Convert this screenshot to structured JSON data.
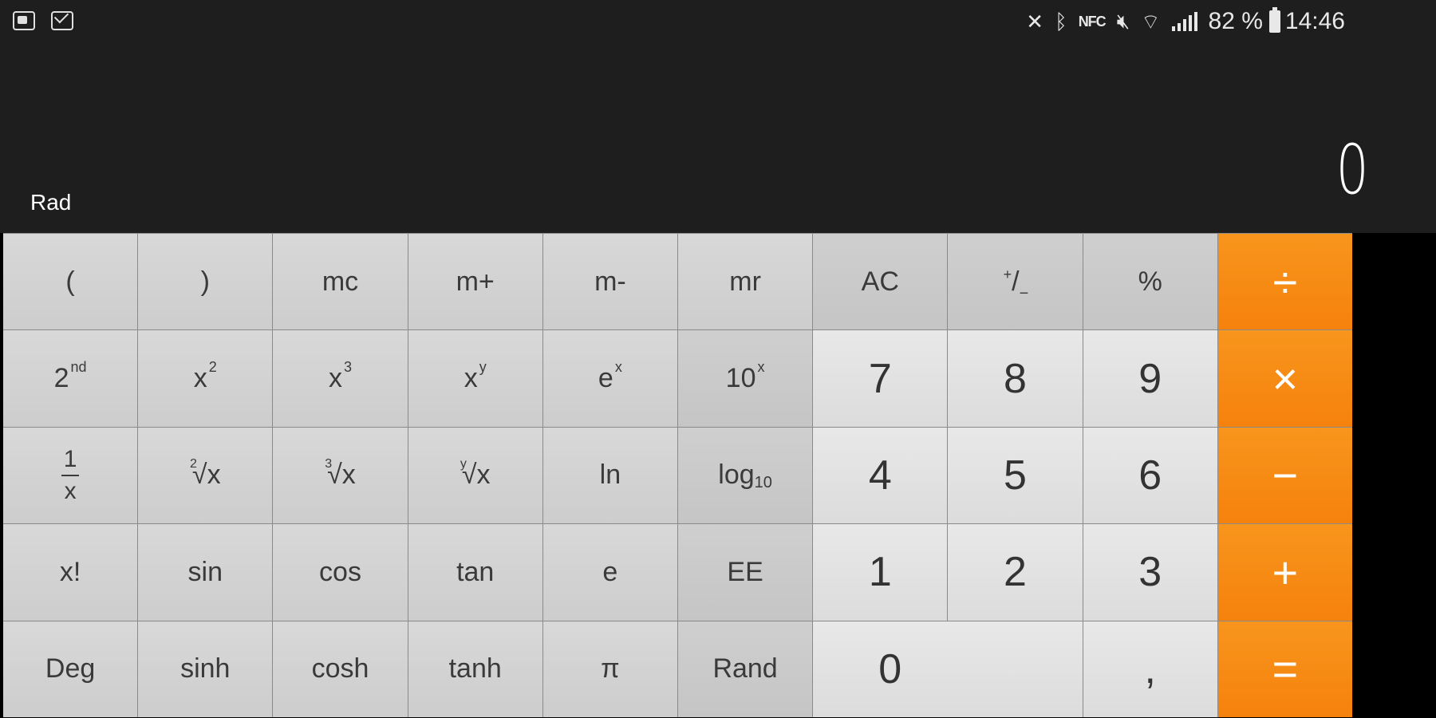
{
  "status_bar": {
    "left_icons": [
      "notification-icon",
      "mail-icon"
    ],
    "right_icons": [
      "x-icon",
      "bluetooth-icon",
      "nfc-icon",
      "mute-icon",
      "wifi-icon",
      "signal-icon"
    ],
    "nfc_label": "NFC",
    "battery_text": "82 %",
    "time": "14:46"
  },
  "display": {
    "mode": "Rad",
    "result": "0"
  },
  "keys": {
    "open_paren": "(",
    "close_paren": ")",
    "mc": "mc",
    "m_plus": "m+",
    "m_minus": "m-",
    "mr": "mr",
    "ac": "AC",
    "plus_minus_a": "+",
    "plus_minus_b": "/",
    "plus_minus_c": "−",
    "percent": "%",
    "divide": "÷",
    "second_base": "2",
    "second_sup": "nd",
    "x_sq_base": "x",
    "x_sq_sup": "2",
    "x_cube_base": "x",
    "x_cube_sup": "3",
    "x_y_base": "x",
    "x_y_sup": "y",
    "e_x_base": "e",
    "e_x_sup": "x",
    "ten_x_base": "10",
    "ten_x_sup": "x",
    "seven": "7",
    "eight": "8",
    "nine": "9",
    "multiply": "×",
    "inv_num": "1",
    "inv_den": "x",
    "sqrt2_idx": "2",
    "sqrt2_body": "√x",
    "sqrt3_idx": "3",
    "sqrt3_body": "√x",
    "sqrty_idx": "y",
    "sqrty_body": "√x",
    "ln": "ln",
    "log_base": "log",
    "log_sub": "10",
    "four": "4",
    "five": "5",
    "six": "6",
    "minus": "−",
    "factorial": "x!",
    "sin": "sin",
    "cos": "cos",
    "tan": "tan",
    "e": "e",
    "ee": "EE",
    "one": "1",
    "two": "2",
    "three": "3",
    "plus": "+",
    "deg": "Deg",
    "sinh": "sinh",
    "cosh": "cosh",
    "tanh": "tanh",
    "pi": "π",
    "rand": "Rand",
    "zero": "0",
    "comma": ",",
    "equals": "="
  },
  "colors": {
    "operator_orange": "#f5820d",
    "display_bg": "#1e1e1e"
  }
}
